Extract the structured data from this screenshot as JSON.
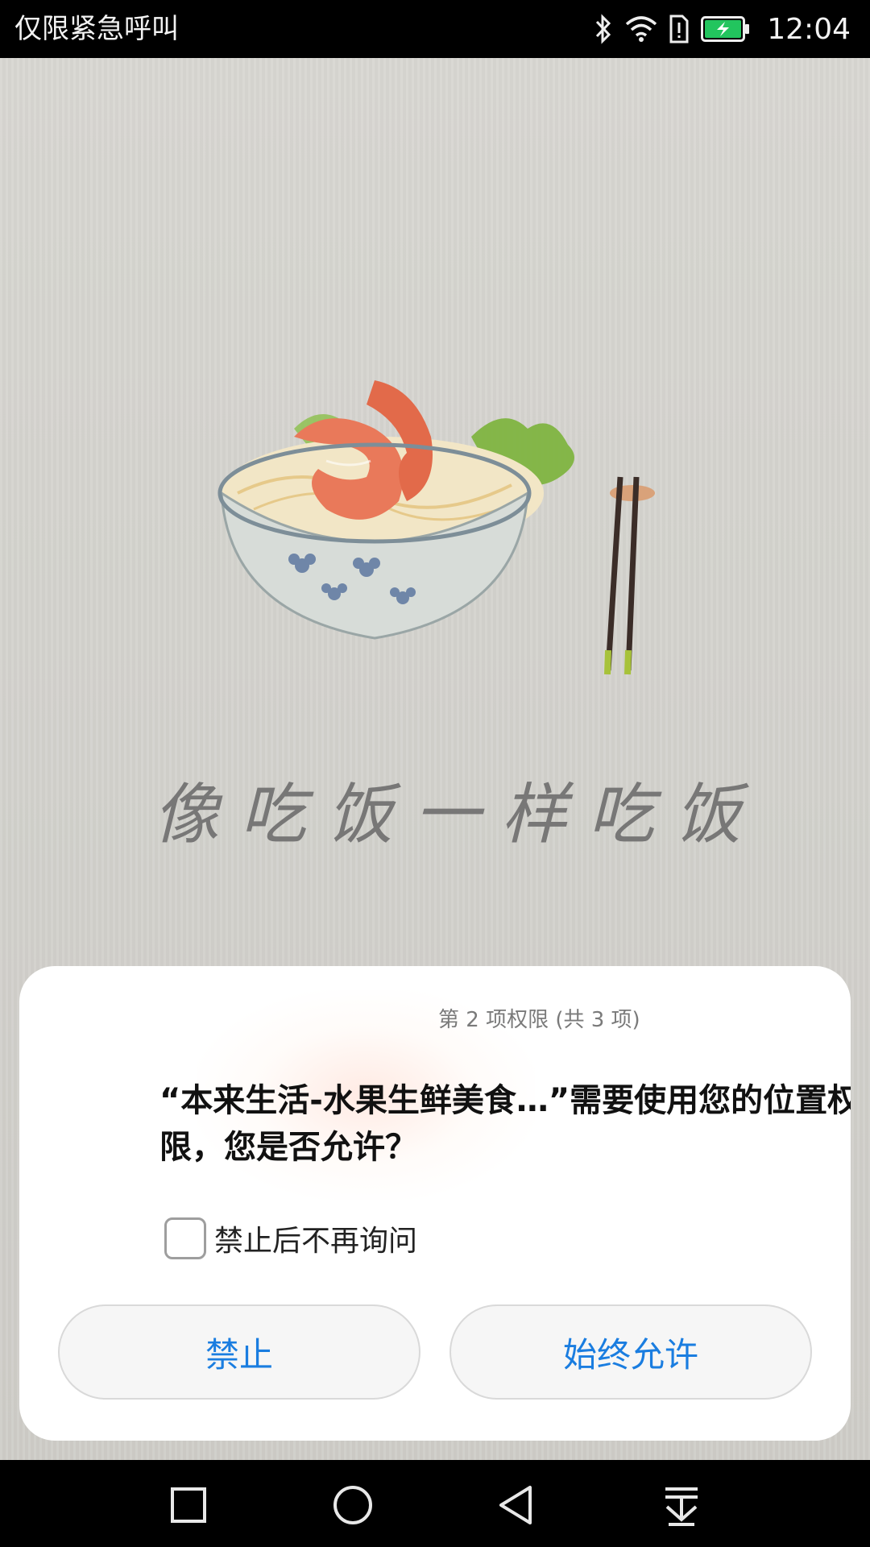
{
  "status_bar": {
    "carrier_text": "仅限紧急呼叫",
    "time": "12:04",
    "icons": [
      "bluetooth-icon",
      "wifi-icon",
      "sim-alert-icon",
      "battery-charging-icon"
    ],
    "battery_color": "#22c55e"
  },
  "app": {
    "slogan": "像吃饭一样吃饭",
    "illustration": "bowl-of-shrimp-noodles-with-chopsticks"
  },
  "dialog": {
    "step_text": "第 2 项权限 (共 3 项)",
    "message": "“本来生活-水果生鲜美食…”需要使用您的位置权\n限，您是否允许？",
    "checkbox_label": "禁止后不再询问",
    "checkbox_checked": false,
    "deny_label": "禁止",
    "allow_label": "始终允许",
    "accent_color": "#1a7de0"
  },
  "nav_bar": {
    "buttons": [
      "recents-square-icon",
      "home-circle-icon",
      "back-triangle-icon",
      "notification-pull-down-icon"
    ]
  }
}
